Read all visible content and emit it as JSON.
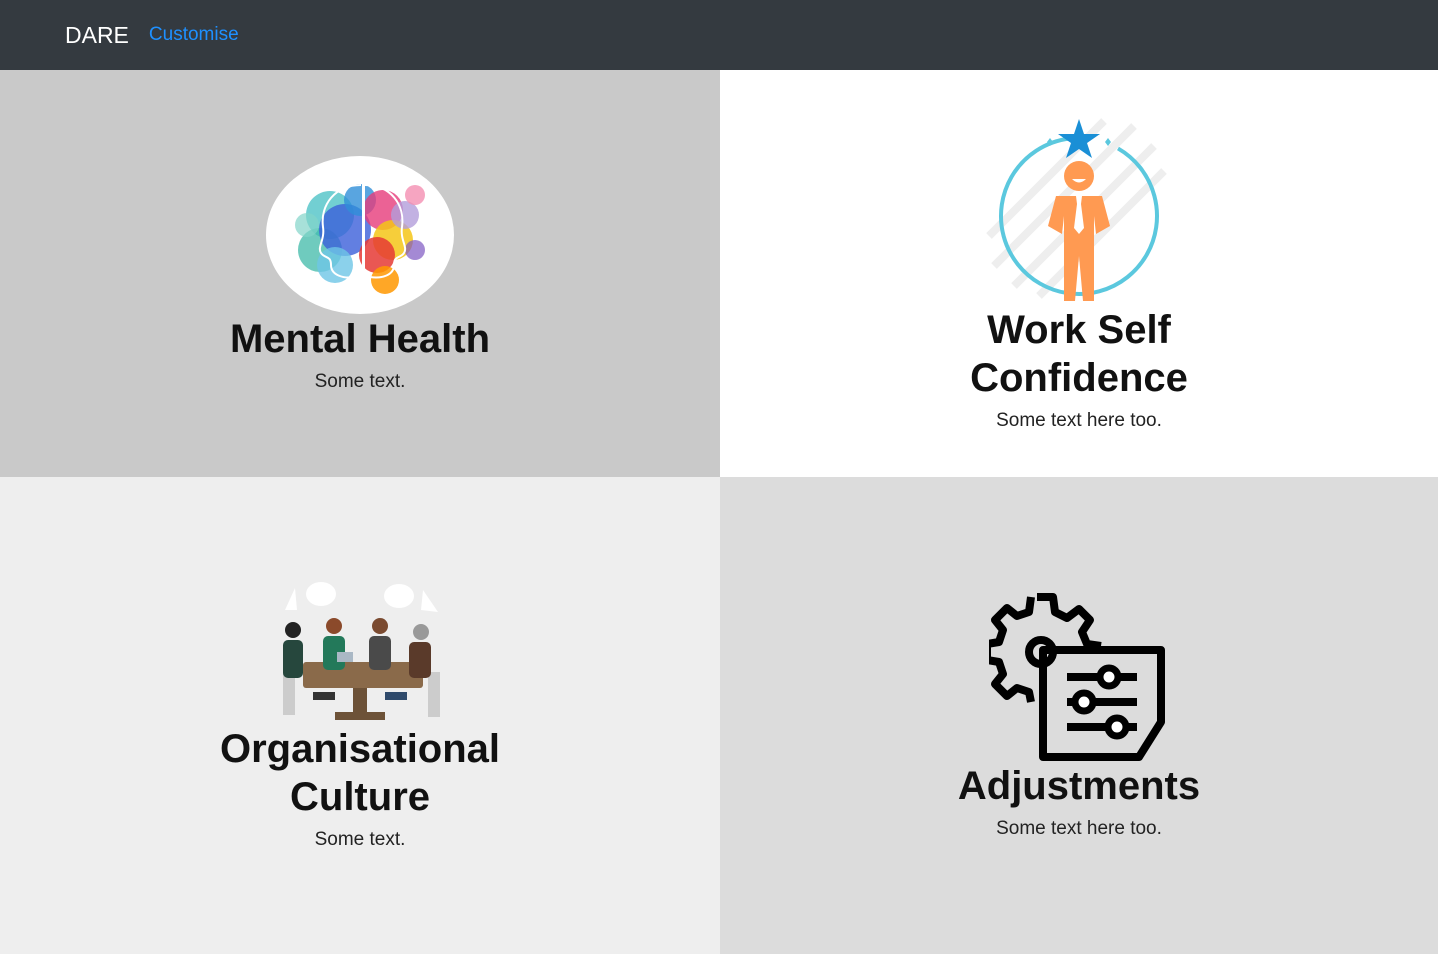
{
  "nav": {
    "brand": "DARE",
    "links": [
      "Customise"
    ]
  },
  "cards": [
    {
      "title": "Mental Health",
      "text": "Some text.",
      "image": "colorful-head-profile-illustration"
    },
    {
      "title": "Work Self Confidence",
      "text": "Some text here too.",
      "image": "confident-person-star-icon"
    },
    {
      "title": "Organisational Culture",
      "text": "Some text.",
      "image": "team-meeting-illustration"
    },
    {
      "title": "Adjustments",
      "text": "Some text here too.",
      "image": "gear-settings-icon"
    }
  ],
  "colors": {
    "navbar": "#343a40",
    "link": "#1e90ff",
    "card1_bg": "#c9c9c9",
    "card2_bg": "#ffffff",
    "card3_bg": "#eeeeee",
    "card4_bg": "#dcdcdc"
  }
}
